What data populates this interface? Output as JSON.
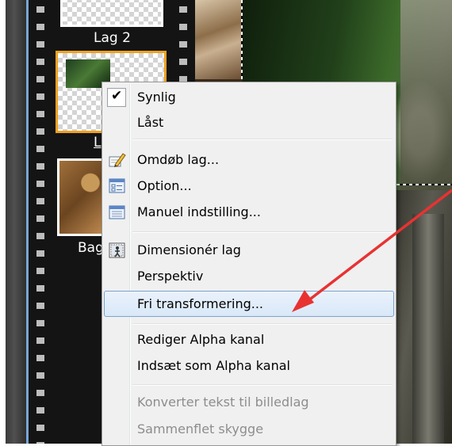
{
  "layers": {
    "items": [
      {
        "label": "Lag 2"
      },
      {
        "label": "L"
      },
      {
        "label": "Bag"
      }
    ]
  },
  "context_menu": {
    "items": [
      {
        "label": "Synlig",
        "icon": "check-icon",
        "checked": true
      },
      {
        "label": "Låst"
      },
      {
        "label": "Omdøb lag...",
        "icon": "rename-icon"
      },
      {
        "label": "Option...",
        "icon": "options-icon"
      },
      {
        "label": "Manuel indstilling...",
        "icon": "manual-setting-icon"
      },
      {
        "label": "Dimensionér lag",
        "icon": "resize-layer-icon"
      },
      {
        "label": "Perspektiv"
      },
      {
        "label": "Fri transformering...",
        "highlighted": true
      },
      {
        "label": "Rediger Alpha kanal"
      },
      {
        "label": "Indsæt som Alpha kanal"
      },
      {
        "label": "Konverter tekst til billedlag",
        "disabled": true
      },
      {
        "label": "Sammenflet skygge",
        "disabled": true
      }
    ]
  },
  "annotation": {
    "arrow_color": "#e83232"
  }
}
